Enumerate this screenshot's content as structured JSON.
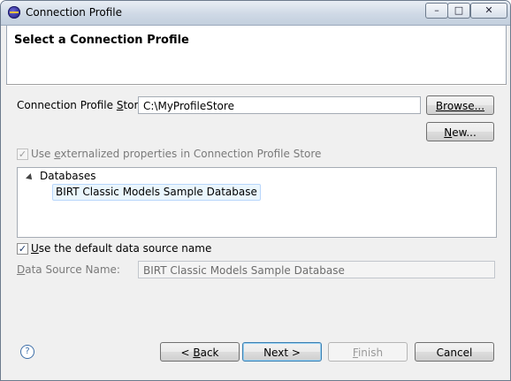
{
  "window": {
    "title": "Connection Profile",
    "minimize_glyph": "–",
    "maximize_glyph": "□",
    "close_glyph": "✕"
  },
  "banner": {
    "title": "Select a Connection Profile"
  },
  "store": {
    "label_pre": "Connection Profile ",
    "label_accel": "S",
    "label_post": "tore:",
    "value": "C:\\MyProfileStore",
    "browse_label": "Browse...",
    "browse_accel_pre": "",
    "new_pre": "",
    "new_accel": "N",
    "new_post": "ew..."
  },
  "externalized": {
    "checked": true,
    "enabled": false,
    "label_pre": "Use ",
    "label_accel": "e",
    "label_post": "xternalized properties in Connection Profile Store"
  },
  "tree": {
    "category": "Databases",
    "items": [
      "BIRT Classic Models Sample Database"
    ]
  },
  "default_name": {
    "checked": true,
    "label_accel": "U",
    "label_post": "se the default data source name"
  },
  "data_source": {
    "label_accel": "D",
    "label_post": "ata Source Name:",
    "value": "BIRT Classic Models Sample Database"
  },
  "footer": {
    "help_glyph": "?",
    "back_pre": "< ",
    "back_accel": "B",
    "back_post": "ack",
    "next_label": "Next >",
    "finish_accel": "F",
    "finish_post": "inish",
    "cancel_label": "Cancel"
  },
  "icons": {
    "app": "eclipse-icon",
    "help": "help-icon",
    "tree_expand": "tree-expand-icon",
    "check": "checkmark"
  }
}
